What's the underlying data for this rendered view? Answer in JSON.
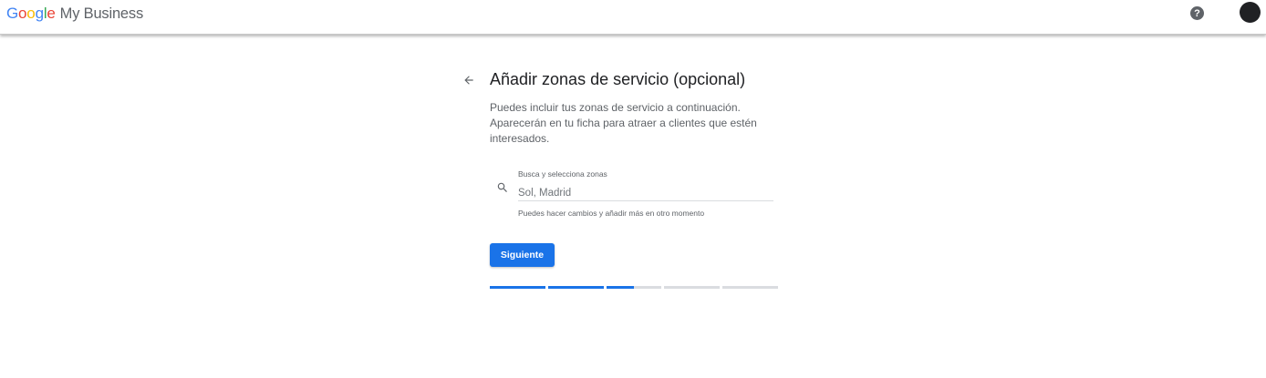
{
  "header": {
    "logo_google": "Google",
    "product_name": "My Business",
    "help_label": "?",
    "colors": {
      "g1": "#4285F4",
      "o1": "#EA4335",
      "o2": "#FBBC05",
      "g2": "#4285F4",
      "l": "#34A853",
      "e": "#EA4335"
    }
  },
  "page": {
    "title": "Añadir zonas de servicio (opcional)",
    "description": "Puedes incluir tus zonas de servicio a continuación. Aparecerán en tu ficha para atraer a clientes que estén interesados."
  },
  "search": {
    "label": "Busca y selecciona zonas",
    "placeholder": "Sol, Madrid",
    "value": "",
    "helper": "Puedes hacer cambios y añadir más en otro momento",
    "icon": "search-icon"
  },
  "actions": {
    "next_label": "Siguiente",
    "accent": "#1a73e8"
  },
  "progress": {
    "segments": [
      1,
      1,
      0.5,
      0,
      0
    ]
  }
}
